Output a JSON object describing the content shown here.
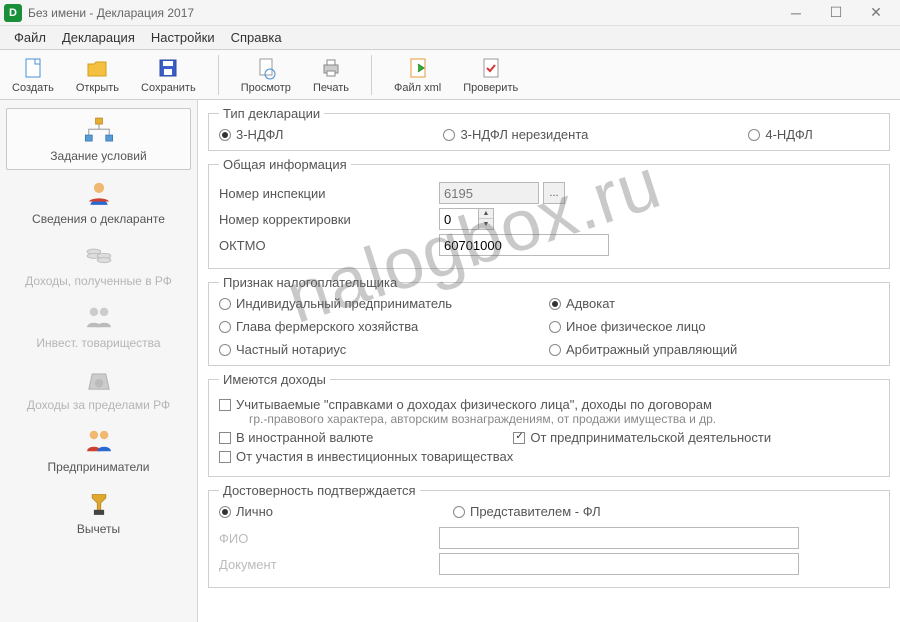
{
  "window": {
    "title": "Без имени - Декларация 2017",
    "app_icon_letter": "D"
  },
  "menu": {
    "items": [
      "Файл",
      "Декларация",
      "Настройки",
      "Справка"
    ]
  },
  "toolbar": {
    "create": "Создать",
    "open": "Открыть",
    "save": "Сохранить",
    "preview": "Просмотр",
    "print": "Печать",
    "file_xml": "Файл xml",
    "check": "Проверить"
  },
  "sidebar": {
    "items": [
      {
        "label": "Задание условий",
        "active": true,
        "disabled": false
      },
      {
        "label": "Сведения о декларанте",
        "active": false,
        "disabled": false
      },
      {
        "label": "Доходы, полученные в РФ",
        "active": false,
        "disabled": true
      },
      {
        "label": "Инвест. товарищества",
        "active": false,
        "disabled": true
      },
      {
        "label": "Доходы за пределами РФ",
        "active": false,
        "disabled": true
      },
      {
        "label": "Предприниматели",
        "active": false,
        "disabled": false
      },
      {
        "label": "Вычеты",
        "active": false,
        "disabled": false
      }
    ]
  },
  "content": {
    "decl_type": {
      "legend": "Тип декларации",
      "opt1": "3-НДФЛ",
      "opt2": "3-НДФЛ нерезидента",
      "opt3": "4-НДФЛ",
      "selected": "opt1"
    },
    "general": {
      "legend": "Общая информация",
      "inspection_label": "Номер инспекции",
      "inspection_value": "6195",
      "picker_button": "...",
      "correction_label": "Номер корректировки",
      "correction_value": "0",
      "oktmo_label": "ОКТМО",
      "oktmo_value": "60701000"
    },
    "taxpayer": {
      "legend": "Признак налогоплательщика",
      "opt_ip": "Индивидуальный предприниматель",
      "opt_advokat": "Адвокат",
      "opt_farmer": "Глава фермерского хозяйства",
      "opt_other": "Иное физическое лицо",
      "opt_notary": "Частный нотариус",
      "opt_arbitr": "Арбитражный управляющий",
      "selected": "opt_advokat"
    },
    "income": {
      "legend": "Имеются доходы",
      "chk1": "Учитываемые \"справками о доходах физического лица\", доходы по договорам",
      "chk1_sub": "гр.-правового характера, авторским вознаграждениям, от продажи имущества и др.",
      "chk2": "В иностранной валюте",
      "chk3": "От предпринимательской деятельности",
      "chk3_checked": true,
      "chk4": "От участия в инвестиционных товариществах"
    },
    "confirm": {
      "legend": "Достоверность подтверждается",
      "opt1": "Лично",
      "opt2": "Представителем - ФЛ",
      "selected": "opt1",
      "fio_label": "ФИО",
      "fio_value": "",
      "doc_label": "Документ",
      "doc_value": ""
    }
  },
  "watermark": "nalogbox.ru"
}
